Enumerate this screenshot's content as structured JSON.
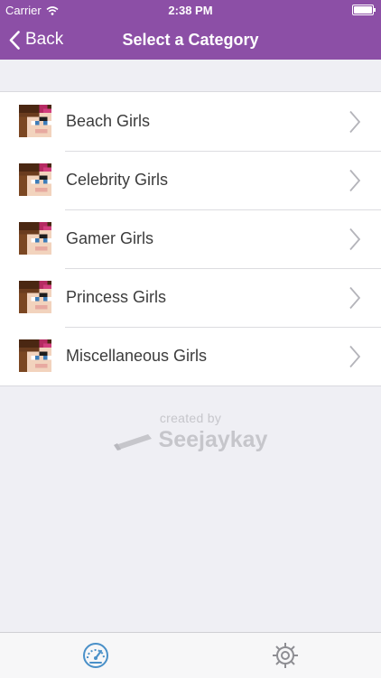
{
  "status_bar": {
    "carrier": "Carrier",
    "time": "2:38 PM"
  },
  "nav": {
    "back_label": "Back",
    "title": "Select a Category"
  },
  "categories": [
    {
      "label": "Beach Girls",
      "icon": "girl-avatar-icon"
    },
    {
      "label": "Celebrity Girls",
      "icon": "girl-avatar-icon"
    },
    {
      "label": "Gamer Girls",
      "icon": "girl-avatar-icon"
    },
    {
      "label": "Princess Girls",
      "icon": "girl-avatar-icon"
    },
    {
      "label": "Miscellaneous Girls",
      "icon": "girl-avatar-icon"
    }
  ],
  "footer": {
    "created_by": "created by",
    "brand": "Seejaykay"
  },
  "tab_bar": {
    "tabs": [
      {
        "icon": "dashboard-icon",
        "active": true
      },
      {
        "icon": "settings-icon",
        "active": false
      }
    ]
  },
  "colors": {
    "nav_bg": "#8c4fa6",
    "background": "#efeff4",
    "tab_active": "#4a90c8",
    "footer_text": "#c6c6cb"
  }
}
